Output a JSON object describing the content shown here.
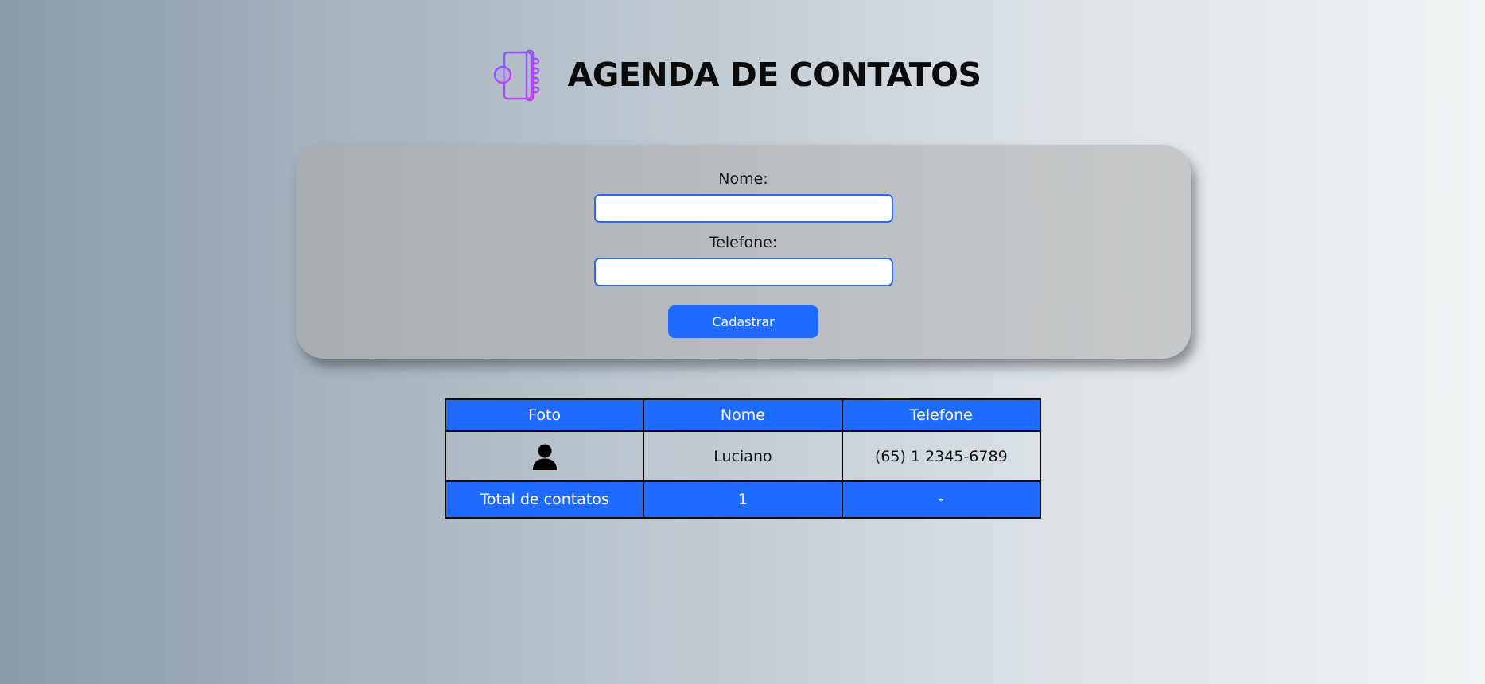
{
  "header": {
    "title": "AGENDA DE CONTATOS",
    "logo_icon": "address-book-icon"
  },
  "form": {
    "name_label": "Nome:",
    "name_value": "",
    "phone_label": "Telefone:",
    "phone_value": "",
    "submit_label": "Cadastrar"
  },
  "table": {
    "columns": [
      "Foto",
      "Nome",
      "Telefone"
    ],
    "rows": [
      {
        "photo_icon": "user-silhouette-icon",
        "name": "Luciano",
        "phone": "(65) 1 2345-6789"
      }
    ],
    "footer": {
      "label": "Total de contatos",
      "count": "1",
      "dash": "-"
    }
  },
  "colors": {
    "accent": "#1f6bff",
    "input_border": "#2a6ae6",
    "logo_gradient_start": "#7a5cff",
    "logo_gradient_end": "#d13cff"
  }
}
